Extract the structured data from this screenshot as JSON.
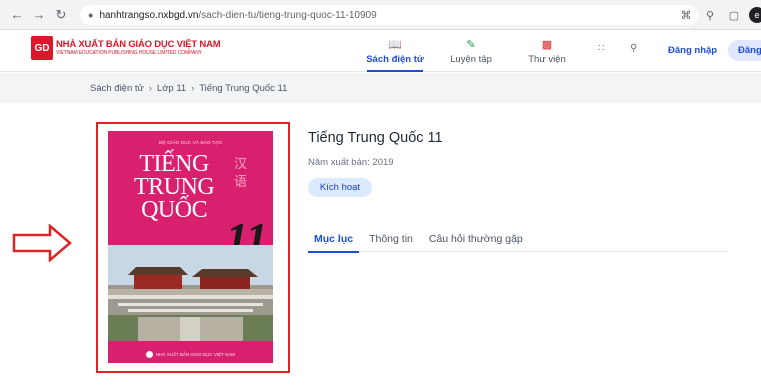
{
  "browser": {
    "back_icon": "arrow-left-icon",
    "forward_icon": "arrow-right-icon",
    "reload_icon": "reload-icon",
    "url_domain": "hanhtrangso.nxbgd.vn",
    "url_path": "/sach-dien-tu/tieng-trung-quoc-11-10909",
    "profile_initial": "e"
  },
  "header": {
    "logo_mark": "GD",
    "logo_title": "NHÀ XUẤT BẢN GIÁO DỤC VIỆT NAM",
    "logo_subtitle": "VIETNAM EDUCATION PUBLISHING HOUSE LIMITED COMPANY",
    "nav": [
      {
        "label": "Sách điện tử",
        "icon": "book-open-icon",
        "active": true
      },
      {
        "label": "Luyện tập",
        "icon": "pencil-icon",
        "active": false
      },
      {
        "label": "Thư viện",
        "icon": "library-icon",
        "active": false
      }
    ],
    "login_label": "Đăng nhập",
    "signup_label": "Đăng ký"
  },
  "breadcrumb": [
    "Sách điện tử",
    "Lớp 11",
    "Tiếng Trung Quốc 11"
  ],
  "book": {
    "cover_top_text": "BỘ GIÁO DỤC VÀ ĐÀO TẠO",
    "cover_title_line1": "TIẾNG",
    "cover_title_line2": "TRUNG",
    "cover_title_line3": "QUỐC",
    "cover_grade": "11",
    "cover_chars": [
      "汉",
      "语"
    ],
    "cover_bottom_text": "NHÀ XUẤT BẢN GIÁO DỤC VIỆT NAM",
    "title": "Tiếng Trung Quốc 11",
    "pub_year": "Năm xuất bản: 2019",
    "activate_label": "Kích hoạt"
  },
  "tabs": [
    {
      "label": "Mục lục",
      "active": true
    },
    {
      "label": "Thông tin",
      "active": false
    },
    {
      "label": "Câu hỏi thường gặp",
      "active": false
    }
  ],
  "colors": {
    "brand_red": "#d7192b",
    "accent_blue": "#1d4ed8",
    "cover_pink": "#d8206e",
    "highlight_red": "#dc2626"
  }
}
